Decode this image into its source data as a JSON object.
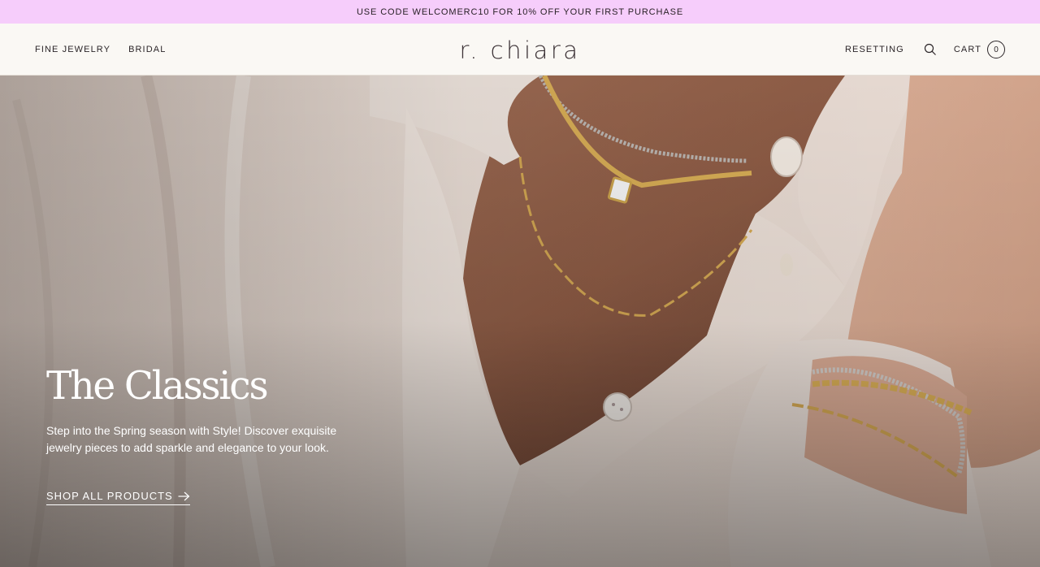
{
  "announcement": {
    "text": "USE CODE WELCOMERC10 FOR 10% OFF YOUR FIRST PURCHASE"
  },
  "header": {
    "logo": "r. chiara",
    "nav_left": [
      {
        "label": "FINE JEWELRY"
      },
      {
        "label": "BRIDAL"
      }
    ],
    "nav_right": {
      "resetting_label": "RESETTING",
      "search_icon": "search-icon",
      "cart_label": "CART",
      "cart_count": "0"
    }
  },
  "hero": {
    "title": "The Classics",
    "description": "Step into the Spring season with Style! Discover exquisite jewelry pieces to add sparkle and elegance to your look.",
    "cta_label": "SHOP ALL PRODUCTS",
    "cta_icon": "arrow-right-icon"
  },
  "colors": {
    "announcement_bg": "#f6cdfb",
    "header_bg": "#faf8f4",
    "text_dark": "#2b2528",
    "hero_text": "#ffffff"
  }
}
